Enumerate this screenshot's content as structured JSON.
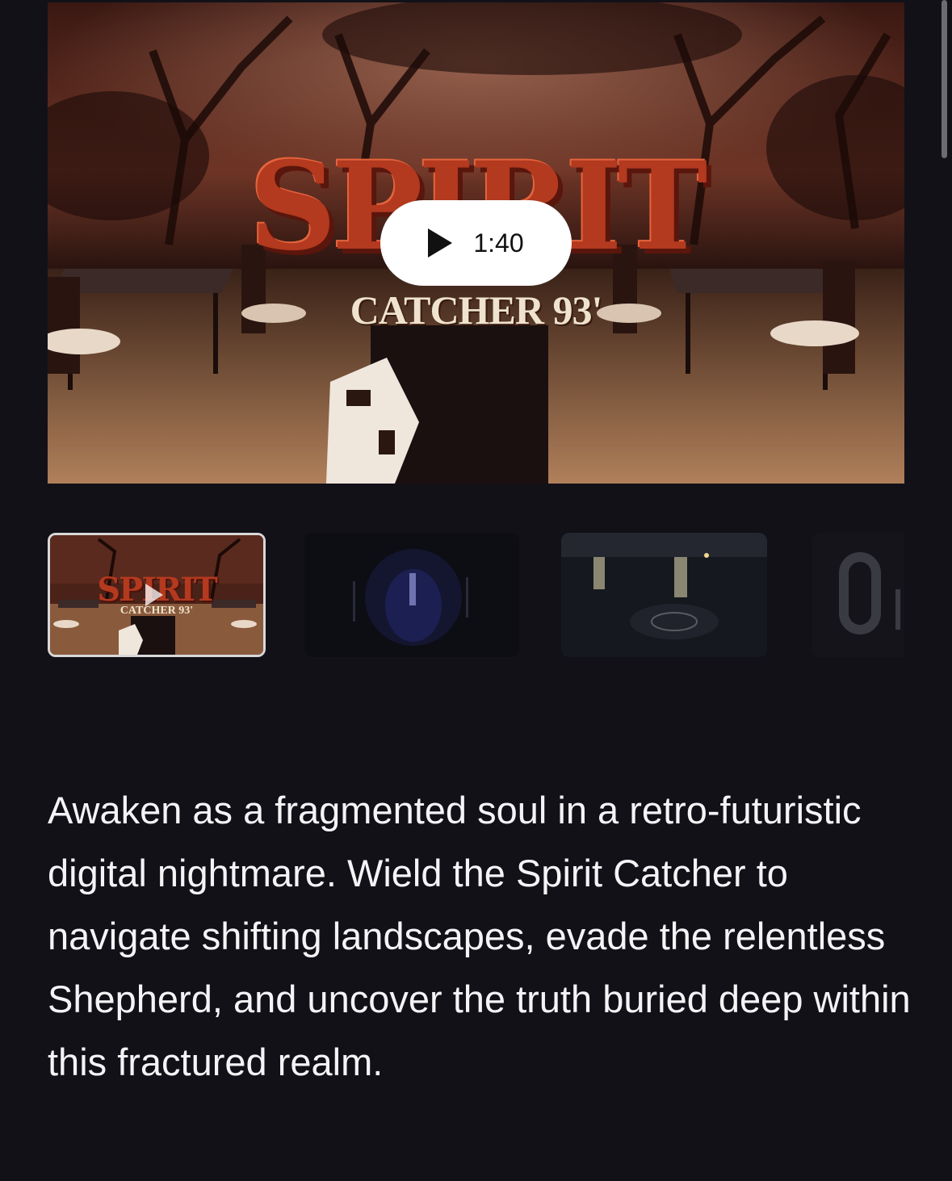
{
  "media": {
    "logo_title": "SPIRIT",
    "logo_subtitle": "CATCHER 93'",
    "duration": "1:40",
    "play_icon": "play-icon"
  },
  "thumbnails": [
    {
      "kind": "video",
      "logo_title": "SPIRIT",
      "logo_subtitle": "CATCHER 93'",
      "selected": true
    },
    {
      "kind": "image",
      "selected": false
    },
    {
      "kind": "image",
      "selected": false
    },
    {
      "kind": "image",
      "selected": false
    }
  ],
  "description": "Awaken as a fragmented soul in a retro-futuristic digital nightmare. Wield the Spirit Catcher to navigate shifting landscapes, evade the relentless Shepherd, and uncover the truth buried deep within this fractured realm."
}
